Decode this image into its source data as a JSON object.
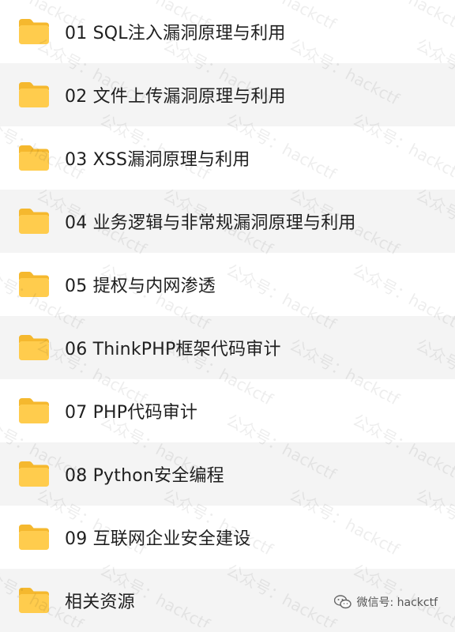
{
  "folders": [
    {
      "label": "01  SQL注入漏洞原理与利用"
    },
    {
      "label": "02  文件上传漏洞原理与利用"
    },
    {
      "label": "03  XSS漏洞原理与利用"
    },
    {
      "label": "04 业务逻辑与非常规漏洞原理与利用"
    },
    {
      "label": "05 提权与内网渗透"
    },
    {
      "label": "06 ThinkPHP框架代码审计"
    },
    {
      "label": "07 PHP代码审计"
    },
    {
      "label": "08 Python安全编程"
    },
    {
      "label": "09 互联网企业安全建设"
    },
    {
      "label": "相关资源"
    }
  ],
  "watermark_text": "公众号：hackctf",
  "footer": {
    "text": "微信号: hackctf",
    "icon": "wechat-icon"
  },
  "colors": {
    "folder": "#FFCC4D",
    "folder_tab": "#F5B82E",
    "alt_row": "#f4f4f4"
  }
}
